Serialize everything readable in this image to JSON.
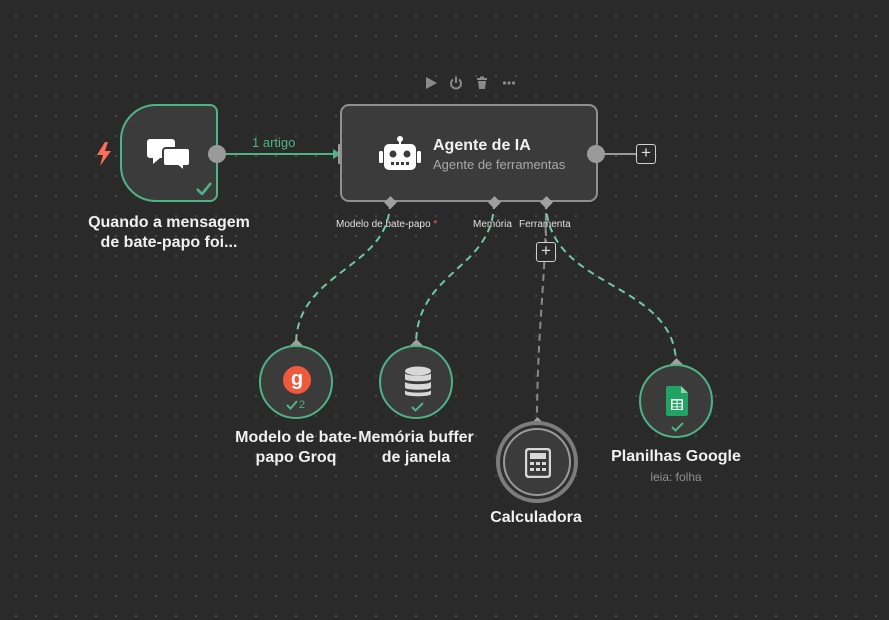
{
  "colors": {
    "success": "#4fb386",
    "trigger_icon": "#ff6d5a",
    "groq": "#f05a3c",
    "sheets": "#1fa463",
    "required": "#ff5c5c"
  },
  "toolbar": {
    "icons": [
      "play-icon",
      "power-icon",
      "trash-icon",
      "more-icon"
    ]
  },
  "trigger": {
    "icon": "chat-bubbles-icon",
    "label_line1": "Quando a mensagem",
    "label_line2": "de bate-papo foi..."
  },
  "edge": {
    "label": "1 artigo"
  },
  "agent": {
    "icon": "robot-icon",
    "title": "Agente de IA",
    "subtitle": "Agente de ferramentas",
    "connectors": {
      "chat_model": "Modelo de bate-papo",
      "required_mark": "*",
      "memory": "Memória",
      "tool": "Ferramenta"
    }
  },
  "groq": {
    "icon": "groq-icon",
    "glyph": "g",
    "check_count": "2",
    "label_line1": "Modelo de bate-",
    "label_line2": "papo Groq"
  },
  "memory": {
    "icon": "database-icon",
    "label_line1": "Memória buffer",
    "label_line2": "de janela"
  },
  "calculator": {
    "icon": "calculator-icon",
    "label": "Calculadora"
  },
  "sheets": {
    "icon": "google-sheets-icon",
    "label": "Planilhas Google",
    "sublabel": "leia: folha"
  }
}
